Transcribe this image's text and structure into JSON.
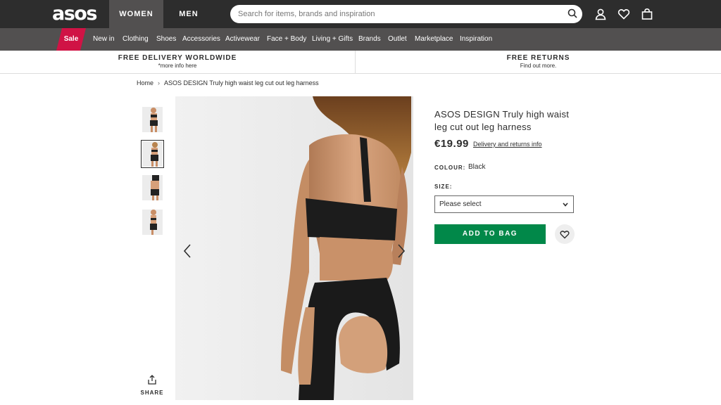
{
  "header": {
    "logo": "asos",
    "tabs": [
      "WOMEN",
      "MEN"
    ],
    "search_placeholder": "Search for items, brands and inspiration"
  },
  "nav": {
    "sale": "Sale",
    "items": [
      "New in",
      "Clothing",
      "Shoes",
      "Accessories",
      "Activewear",
      "Face + Body",
      "Living + Gifts",
      "Brands",
      "Outlet",
      "Marketplace",
      "Inspiration"
    ]
  },
  "promo": {
    "left_title": "FREE DELIVERY WORLDWIDE",
    "left_sub": "*more info here",
    "right_title": "FREE RETURNS",
    "right_sub": "Find out more."
  },
  "breadcrumb": {
    "home": "Home",
    "separator": "›",
    "current": "ASOS DESIGN Truly high waist leg cut out leg harness"
  },
  "gallery": {
    "thumbnail_count": 4,
    "selected_thumbnail": 2
  },
  "share_label": "SHARE",
  "product": {
    "title": "ASOS DESIGN Truly high waist leg cut out leg harness",
    "price": "€19.99",
    "delivery_link": "Delivery and returns info",
    "colour_label": "COLOUR:",
    "colour_value": "Black",
    "size_label": "SIZE:",
    "size_value": "Please select",
    "add_to_bag": "ADD TO BAG"
  },
  "colors": {
    "header_bg": "#2d2d2d",
    "nav_bg": "#525050",
    "sale_bg": "#d01345",
    "add_to_bag_bg": "#018849"
  }
}
